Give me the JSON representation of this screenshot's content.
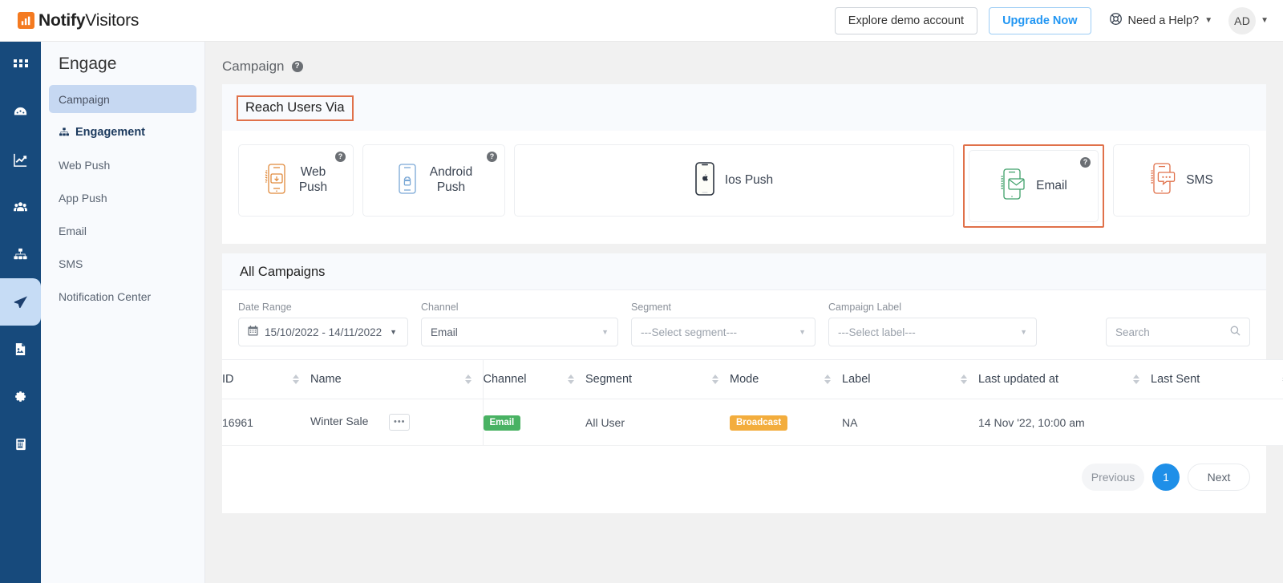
{
  "header": {
    "brand_bold": "Notify",
    "brand_light": "Visitors",
    "demo_button": "Explore demo account",
    "upgrade_button": "Upgrade Now",
    "help_label": "Need a Help?",
    "avatar_initials": "AD",
    "accent_orange": "#f47a20",
    "link_blue": "#2196f3"
  },
  "rail": {
    "items": [
      {
        "name": "dashboard-grid-icon"
      },
      {
        "name": "gauge-icon"
      },
      {
        "name": "analytics-chart-icon"
      },
      {
        "name": "audience-people-icon"
      },
      {
        "name": "sitemap-icon"
      },
      {
        "name": "engage-send-icon"
      },
      {
        "name": "media-image-icon"
      },
      {
        "name": "settings-gear-icon"
      },
      {
        "name": "reports-icon"
      }
    ]
  },
  "sidebar": {
    "title": "Engage",
    "items": [
      {
        "label": "Campaign",
        "state": "selected"
      },
      {
        "label": "Engagement",
        "state": "section"
      },
      {
        "label": "Web Push",
        "state": "normal"
      },
      {
        "label": "App Push",
        "state": "normal"
      },
      {
        "label": "Email",
        "state": "normal"
      },
      {
        "label": "SMS",
        "state": "normal"
      },
      {
        "label": "Notification Center",
        "state": "normal"
      }
    ]
  },
  "page": {
    "title": "Campaign",
    "help_glyph": "?"
  },
  "reach": {
    "heading": "Reach Users Via",
    "highlight_color": "#e0714a",
    "channels": [
      {
        "label_line1": "Web",
        "label_line2": "Push",
        "icon": "web-push-phone-icon",
        "color": "#e08a3c",
        "has_help": true,
        "selected": false
      },
      {
        "label_line1": "Android",
        "label_line2": "Push",
        "icon": "android-push-phone-icon",
        "color": "#7aa8d6",
        "has_help": true,
        "selected": false
      },
      {
        "label_line1": "Ios Push",
        "label_line2": "",
        "icon": "ios-push-phone-icon",
        "color": "#3a4452",
        "has_help": false,
        "selected": false
      },
      {
        "label_line1": "Email",
        "label_line2": "",
        "icon": "email-phone-icon",
        "color": "#3fa06a",
        "has_help": true,
        "selected": true
      },
      {
        "label_line1": "SMS",
        "label_line2": "",
        "icon": "sms-phone-icon",
        "color": "#e0714a",
        "has_help": false,
        "selected": false
      }
    ]
  },
  "campaigns": {
    "section_title": "All Campaigns",
    "filters": {
      "date_range": {
        "label": "Date Range",
        "value": "15/10/2022 - 14/11/2022",
        "icon": "calendar-icon"
      },
      "channel": {
        "label": "Channel",
        "value": "Email"
      },
      "segment": {
        "label": "Segment",
        "value": "---Select segment---"
      },
      "campaign_label": {
        "label": "Campaign Label",
        "value": "---Select label---"
      },
      "search": {
        "placeholder": "Search",
        "value": "",
        "icon": "search-icon"
      }
    },
    "columns": [
      "ID",
      "Name",
      "Channel",
      "Segment",
      "Mode",
      "Label",
      "Last updated at",
      "Last Sent"
    ],
    "rows": [
      {
        "id": "16961",
        "name": "Winter Sale",
        "actions": "•••",
        "channel": "Email",
        "channel_color": "#49b263",
        "segment": "All User",
        "mode": "Broadcast",
        "mode_color": "#f3ad3d",
        "label": "NA",
        "last_updated_at": "14 Nov '22, 10:00 am",
        "last_sent": ""
      }
    ],
    "pagination": {
      "previous": "Previous",
      "current_page": "1",
      "next": "Next"
    }
  }
}
